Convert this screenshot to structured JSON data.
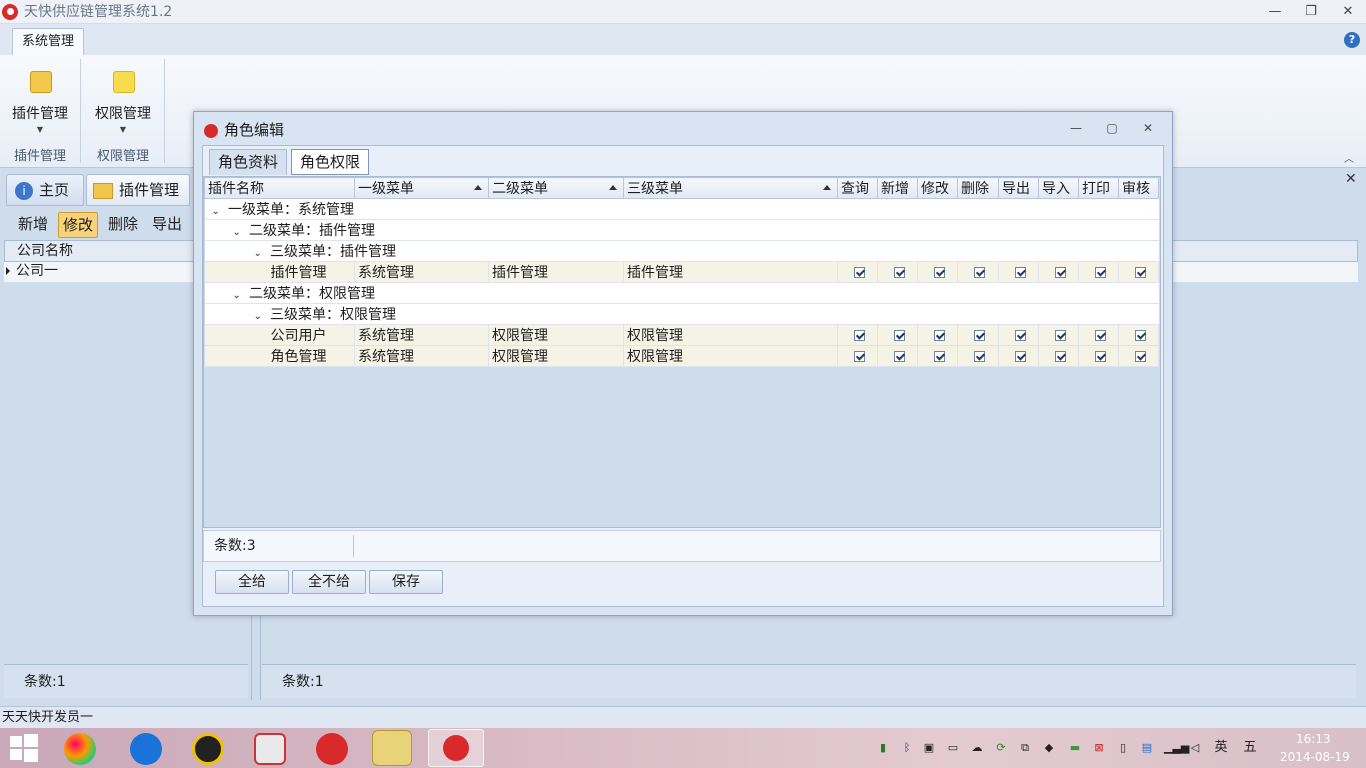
{
  "window": {
    "title": "天快供应链管理系统1.2"
  },
  "ribbon": {
    "tab": "系统管理",
    "buttons": [
      {
        "label": "插件管理",
        "group": "插件管理"
      },
      {
        "label": "权限管理",
        "group": "权限管理"
      }
    ]
  },
  "doc_tabs": [
    "主页",
    "插件管理"
  ],
  "toolbar": {
    "add": "新增",
    "edit": "修改",
    "delete": "删除",
    "export": "导出"
  },
  "left_grid": {
    "header": "公司名称",
    "rows": [
      "公司一"
    ],
    "count": "条数:1"
  },
  "right_footer": {
    "count": "条数:1"
  },
  "status": "天天快开发员一",
  "dialog": {
    "title": "角色编辑",
    "tabs": [
      "角色资料",
      "角色权限"
    ],
    "columns": [
      "插件名称",
      "一级菜单",
      "二级菜单",
      "三级菜单",
      "查询",
      "新增",
      "修改",
      "删除",
      "导出",
      "导入",
      "打印",
      "审核"
    ],
    "groups": {
      "l1": "一级菜单：系统管理",
      "l2a": "二级菜单：插件管理",
      "l3a": "三级菜单：插件管理",
      "l2b": "二级菜单：权限管理",
      "l3b": "三级菜单：权限管理"
    },
    "rows": [
      {
        "name": "插件管理",
        "m1": "系统管理",
        "m2": "插件管理",
        "m3": "插件管理"
      },
      {
        "name": "公司用户",
        "m1": "系统管理",
        "m2": "权限管理",
        "m3": "权限管理"
      },
      {
        "name": "角色管理",
        "m1": "系统管理",
        "m2": "权限管理",
        "m3": "权限管理"
      }
    ],
    "permissions_checked": true,
    "count": "条数:3",
    "buttons": {
      "all": "全给",
      "none": "全不给",
      "save": "保存"
    }
  },
  "taskbar": {
    "time": "16:13",
    "date": "2014-08-19",
    "ime": "英",
    "ime2": "五"
  }
}
